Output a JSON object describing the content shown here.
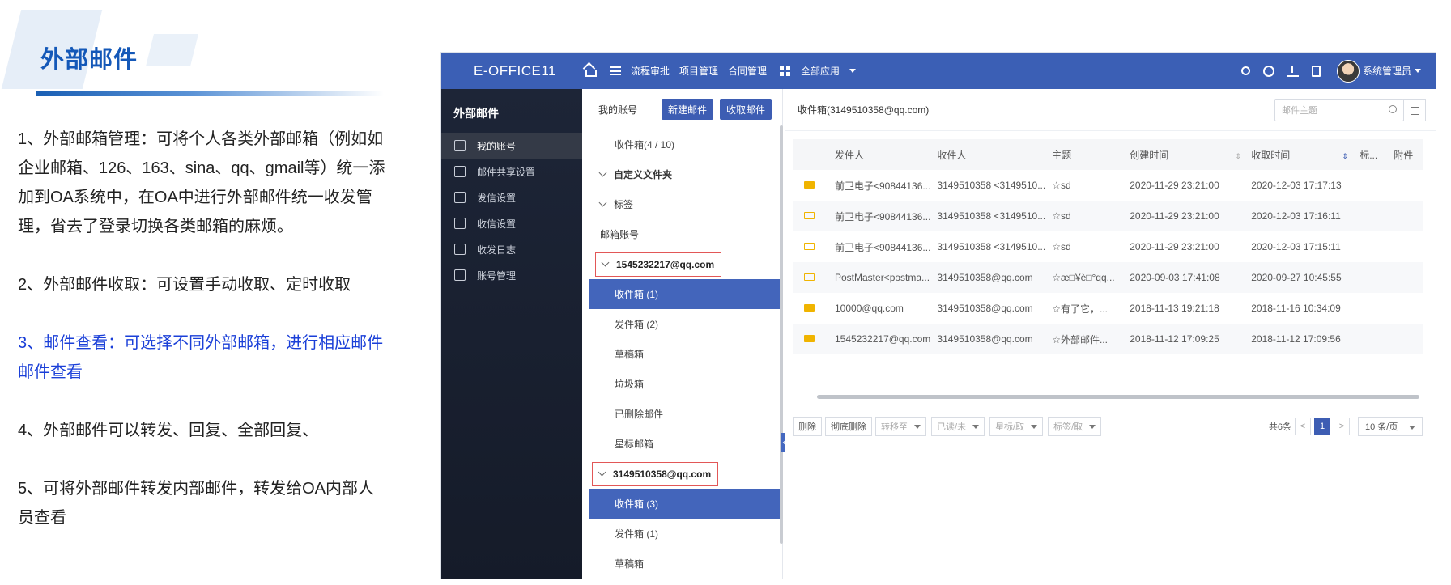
{
  "slide": {
    "title": "外部邮件",
    "points": [
      "1、外部邮箱管理：可将个人各类外部邮箱（例如如企业邮箱、126、163、sina、qq、gmail等）统一添加到OA系统中，在OA中进行外部邮件统一收发管理，省去了登录切换各类邮箱的麻烦。",
      "2、外部邮件收取：可设置手动收取、定时收取",
      "3、邮件查看：可选择不同外部邮箱，进行相应邮件邮件查看",
      "4、外部邮件可以转发、回复、全部回复、",
      "5、可将外部邮件转发内部邮件，转发给OA内部人员查看"
    ],
    "highlight_color": "#1a3fd8"
  },
  "app": {
    "brand": "E-OFFICE11",
    "nav": [
      "流程审批",
      "项目管理",
      "合同管理",
      "全部应用"
    ],
    "user": "系统管理员",
    "accent": "#3b5fb5",
    "sidebar": {
      "title": "外部邮件",
      "items": [
        "我的账号",
        "邮件共享设置",
        "发信设置",
        "收信设置",
        "收发日志",
        "账号管理"
      ]
    },
    "tree": {
      "head": "我的账号",
      "new_btn": "新建邮件",
      "fetch_btn": "收取邮件",
      "inbox_summary": "收件箱(4 / 10)",
      "custom_folder": "自定义文件夹",
      "tags": "标签",
      "mail_accounts": "邮箱账号",
      "account1": "1545232217@qq.com",
      "account1_folders": [
        "收件箱 (1)",
        "发件箱 (2)",
        "草稿箱",
        "垃圾箱",
        "已删除邮件",
        "星标邮箱"
      ],
      "account2": "3149510358@qq.com",
      "account2_folders": [
        "收件箱 (3)",
        "发件箱 (1)",
        "草稿箱"
      ]
    },
    "main": {
      "title": "收件箱(3149510358@qq.com)",
      "search_placeholder": "邮件主题",
      "columns": [
        "发件人",
        "收件人",
        "主题",
        "创建时间",
        "收取时间",
        "标...",
        "附件"
      ],
      "rows": [
        {
          "read": true,
          "from": "前卫电子<90844136...",
          "to": "3149510358 <3149510...",
          "subject": "☆sd",
          "created": "2020-11-29 23:21:00",
          "received": "2020-12-03 17:17:13"
        },
        {
          "read": false,
          "from": "前卫电子<90844136...",
          "to": "3149510358 <3149510...",
          "subject": "☆sd",
          "created": "2020-11-29 23:21:00",
          "received": "2020-12-03 17:16:11"
        },
        {
          "read": false,
          "from": "前卫电子<90844136...",
          "to": "3149510358 <3149510...",
          "subject": "☆sd",
          "created": "2020-11-29 23:21:00",
          "received": "2020-12-03 17:15:11"
        },
        {
          "read": false,
          "from": "PostMaster<postma...",
          "to": "3149510358@qq.com",
          "subject": "☆æ□¥è□°qq...",
          "created": "2020-09-03 17:41:08",
          "received": "2020-09-27 10:45:55"
        },
        {
          "read": true,
          "from": "10000@qq.com",
          "to": "3149510358@qq.com",
          "subject": "☆有了它，...",
          "created": "2018-11-13 19:21:18",
          "received": "2018-11-16 10:34:09"
        },
        {
          "read": true,
          "from": "1545232217@qq.com",
          "to": "3149510358@qq.com",
          "subject": "☆外部邮件...",
          "created": "2018-11-12 17:09:25",
          "received": "2018-11-12 17:09:56"
        }
      ],
      "actions": [
        "删除",
        "彻底删除"
      ],
      "dropdowns": [
        "转移至",
        "已读/未",
        "星标/取",
        "标签/取"
      ],
      "total": "共6条",
      "prev": "<",
      "page": "1",
      "next": ">",
      "page_size": "10 条/页"
    }
  }
}
